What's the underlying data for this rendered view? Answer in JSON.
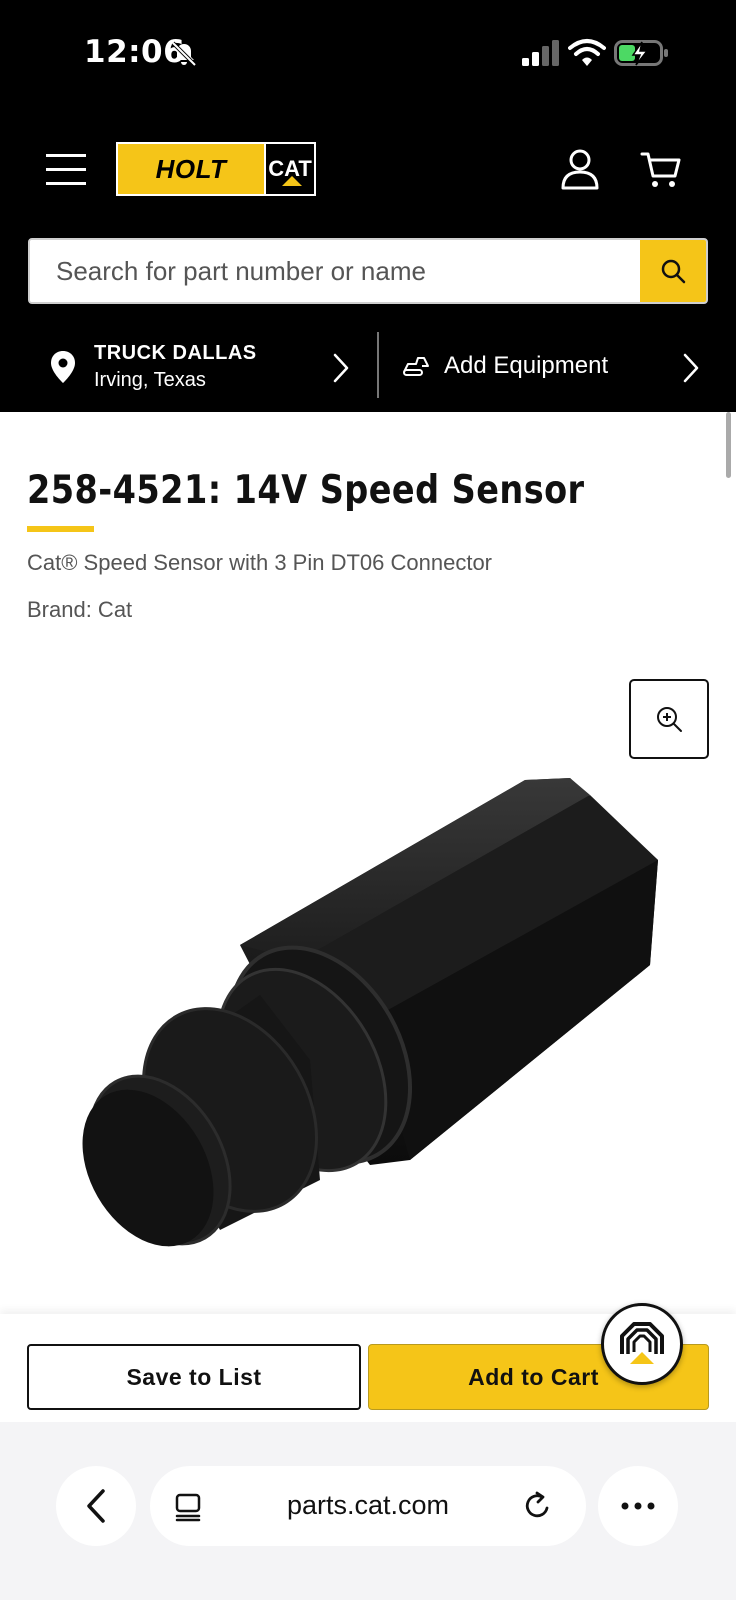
{
  "status_bar": {
    "time": "12:06"
  },
  "header": {
    "logo": {
      "left": "HOLT",
      "right": "CAT"
    },
    "search": {
      "placeholder": "Search for part number or name"
    },
    "store": {
      "name": "TRUCK DALLAS",
      "location": "Irving, Texas"
    },
    "equipment": {
      "label": "Add Equipment"
    }
  },
  "product": {
    "title": "258-4521: 14V Speed Sensor",
    "subtitle": "Cat® Speed Sensor with 3 Pin DT06 Connector",
    "brand": "Brand: Cat"
  },
  "actions": {
    "save_label": "Save to List",
    "cart_label": "Add to Cart"
  },
  "browser": {
    "url": "parts.cat.com"
  },
  "colors": {
    "accent": "#f5c518",
    "header_bg": "#000000",
    "text": "#111111"
  },
  "icons": [
    "bell-slash-icon",
    "signal-icon",
    "wifi-icon",
    "battery-charging-icon",
    "menu-icon",
    "account-icon",
    "cart-icon",
    "search-icon",
    "location-pin-icon",
    "chevron-right-icon",
    "equipment-icon",
    "zoom-in-icon",
    "chat-assistant-icon",
    "back-arrow-icon",
    "tabs-icon",
    "reload-icon",
    "more-icon"
  ]
}
